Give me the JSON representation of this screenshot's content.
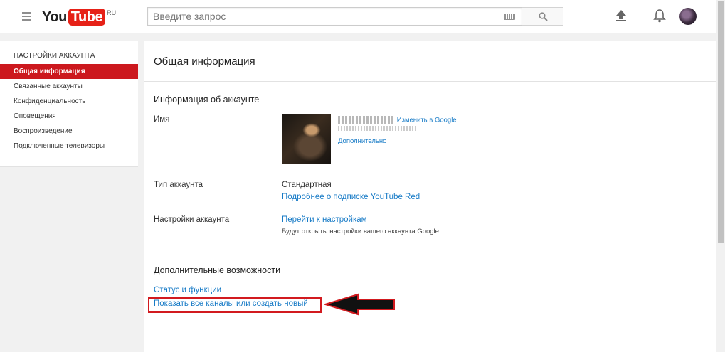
{
  "header": {
    "logo_you": "You",
    "logo_tube": "Tube",
    "logo_region": "RU",
    "search_placeholder": "Введите запрос"
  },
  "sidebar": {
    "title": "НАСТРОЙКИ АККАУНТА",
    "items": [
      {
        "label": "Общая информация",
        "active": true
      },
      {
        "label": "Связанные аккаунты"
      },
      {
        "label": "Конфиденциальность"
      },
      {
        "label": "Оповещения"
      },
      {
        "label": "Воспроизведение"
      },
      {
        "label": "Подключенные телевизоры"
      }
    ]
  },
  "main": {
    "title": "Общая информация",
    "account_section": {
      "title": "Информация об аккаунте",
      "name_label": "Имя",
      "change_in_google_link": "Изменить в Google",
      "more_link": "Дополнительно",
      "account_type_label": "Тип аккаунта",
      "account_type_value": "Стандартная",
      "red_link": "Подробнее о подписке YouTube Red",
      "settings_label": "Настройки аккаунта",
      "settings_link": "Перейти к настройкам",
      "settings_note": "Будут открыты настройки вашего аккаунта Google."
    },
    "extra_section": {
      "title": "Дополнительные возможности",
      "status_link": "Статус и функции",
      "channels_link": "Показать все каналы или создать новый"
    }
  },
  "colors": {
    "brand_red": "#e62117",
    "active_item": "#cc181e",
    "link": "#167ac6",
    "annotation_red": "#d21a1f"
  }
}
